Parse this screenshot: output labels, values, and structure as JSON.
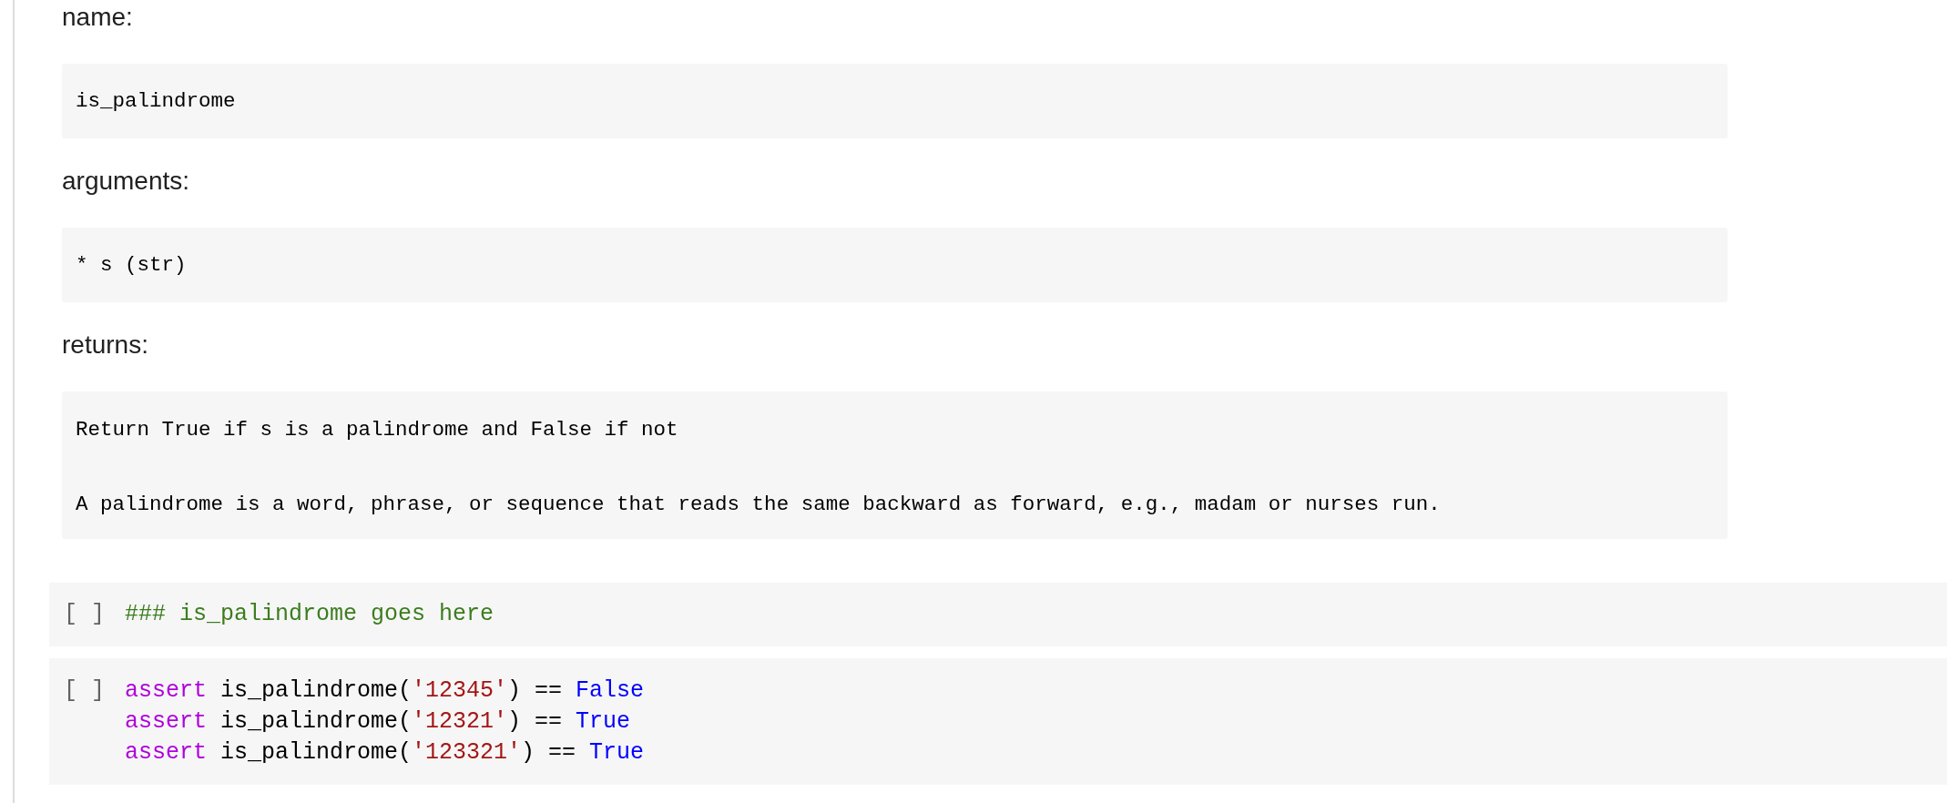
{
  "markdown_cell": {
    "sections": [
      {
        "heading": "name:",
        "code_block": {
          "paragraphs": [
            "is_palindrome"
          ]
        }
      },
      {
        "heading": "arguments:",
        "code_block": {
          "paragraphs": [
            "* s (str)"
          ]
        }
      },
      {
        "heading": "returns:",
        "code_block": {
          "paragraphs": [
            "Return True if s is a palindrome and False if not",
            "A palindrome is a word, phrase, or sequence that reads the same backward as forward, e.g., madam or nurses run."
          ]
        }
      }
    ]
  },
  "code_cells": [
    {
      "execution_count": "[ ]",
      "lines": [
        [
          {
            "kind": "comment",
            "text": "### is_palindrome goes here"
          }
        ]
      ]
    },
    {
      "execution_count": "[ ]",
      "lines": [
        [
          {
            "kind": "keyword",
            "text": "assert"
          },
          {
            "kind": "plain",
            "text": " is_palindrome("
          },
          {
            "kind": "string",
            "text": "'12345'"
          },
          {
            "kind": "plain",
            "text": ") == "
          },
          {
            "kind": "constant",
            "text": "False"
          }
        ],
        [
          {
            "kind": "keyword",
            "text": "assert"
          },
          {
            "kind": "plain",
            "text": " is_palindrome("
          },
          {
            "kind": "string",
            "text": "'12321'"
          },
          {
            "kind": "plain",
            "text": ") == "
          },
          {
            "kind": "constant",
            "text": "True"
          }
        ],
        [
          {
            "kind": "keyword",
            "text": "assert"
          },
          {
            "kind": "plain",
            "text": " is_palindrome("
          },
          {
            "kind": "string",
            "text": "'123321'"
          },
          {
            "kind": "plain",
            "text": ") == "
          },
          {
            "kind": "constant",
            "text": "True"
          }
        ]
      ]
    }
  ]
}
